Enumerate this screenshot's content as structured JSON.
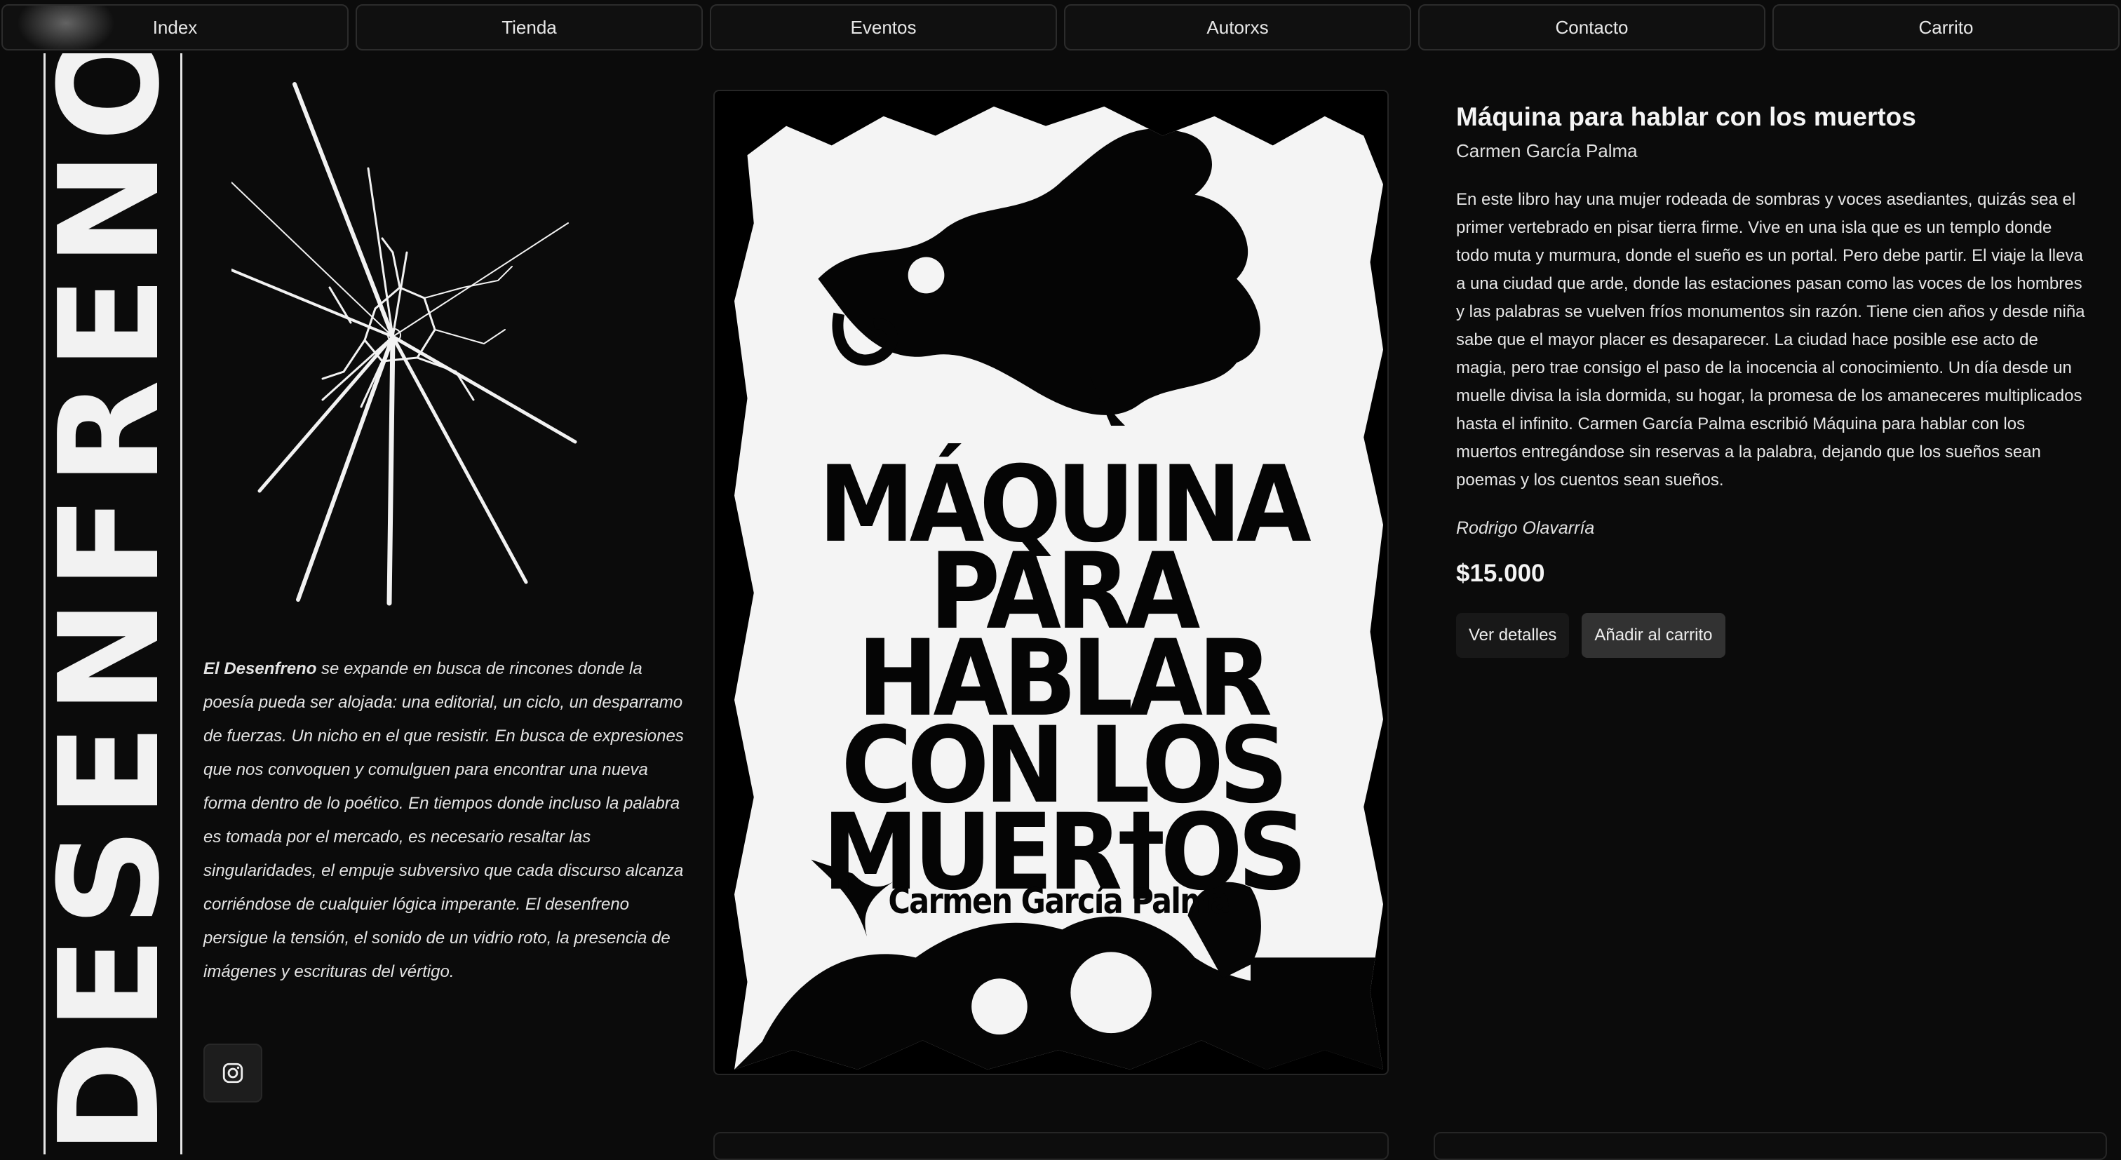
{
  "nav": {
    "items": [
      {
        "label": "Index"
      },
      {
        "label": "Tienda"
      },
      {
        "label": "Eventos"
      },
      {
        "label": "Autorxs"
      },
      {
        "label": "Contacto"
      },
      {
        "label": "Carrito"
      }
    ]
  },
  "brand": {
    "rail_text": "DESENFRENO"
  },
  "about": {
    "lead": "El Desenfreno",
    "text": " se expande en busca de rincones donde la poesía pueda ser alojada: una editorial, un ciclo, un desparramo de fuerzas. Un nicho en el que resistir. En busca de expresiones que nos convoquen y comulguen para encontrar una nueva forma dentro de lo poético. En tiempos donde incluso la palabra es tomada por el mercado, es necesario resaltar las singularidades, el empuje subversivo que cada discurso alcanza corriéndose de cualquier lógica imperante. El desenfreno persigue la tensión, el sonido de un vidrio roto, la presencia de imágenes y escrituras del vértigo."
  },
  "social": {
    "icon": "instagram-icon"
  },
  "cover": {
    "title_lines": [
      "MÁQUINA",
      "PARA",
      "HABLAR",
      "CON LOS",
      "MUER†OS"
    ],
    "author": "Carmen García Palma"
  },
  "book": {
    "title": "Máquina para hablar con los muertos",
    "author": "Carmen García Palma",
    "description": "En este libro hay una mujer rodeada de sombras y voces asediantes, quizás sea el primer vertebrado en pisar tierra firme. Vive en una isla que es un templo donde todo muta y murmura, donde el sueño es un portal. Pero debe partir. El viaje la lleva a una ciudad que arde, donde las estaciones pasan como las voces de los hombres y las palabras se vuelven fríos monumentos sin razón. Tiene cien años y desde niña sabe que el mayor placer es desaparecer. La ciudad hace posible ese acto de magia, pero trae consigo el paso de la inocencia al conocimiento. Un día desde un muelle divisa la isla dormida, su hogar, la promesa de los amaneceres multiplicados hasta el infinito. Carmen García Palma escribió Máquina para hablar con los muertos entregándose sin reservas a la palabra, dejando que los sueños sean poemas y los cuentos sean sueños.",
    "reviewer": "Rodrigo Olavarría",
    "price": "$15.000",
    "details_label": "Ver detalles",
    "add_label": "Añadir al carrito"
  },
  "colors": {
    "background": "#0b0b0b",
    "text": "#ececec",
    "button_add": "#323232",
    "button_details": "#181818"
  }
}
